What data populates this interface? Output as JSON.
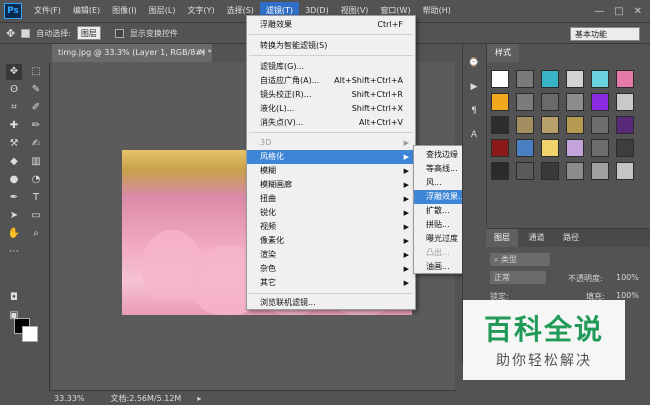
{
  "menubar": {
    "logo": "Ps",
    "items": [
      "文件(F)",
      "编辑(E)",
      "图像(I)",
      "图层(L)",
      "文字(Y)",
      "选择(S)",
      "滤镜(T)",
      "3D(D)",
      "视图(V)",
      "窗口(W)",
      "帮助(H)"
    ],
    "window_buttons": [
      "—",
      "□",
      "✕"
    ]
  },
  "optionsbar": {
    "auto_select_label": "自动选择:",
    "auto_select_value": "图层",
    "show_transform_label": "显示变换控件",
    "workspace": "基本功能"
  },
  "document": {
    "tab_title": "timg.jpg @ 33.3% (Layer 1, RGB/8#) *",
    "zoom": "33.33%",
    "doc_size": "文档:2.56M/5.12M"
  },
  "filter_menu": {
    "items": [
      {
        "label": "浮雕效果",
        "shortcut": "Ctrl+F"
      },
      {
        "label": "转换为智能滤镜(S)"
      },
      {
        "label": "滤镜库(G)..."
      },
      {
        "label": "自适应广角(A)...",
        "shortcut": "Alt+Shift+Ctrl+A"
      },
      {
        "label": "镜头校正(R)...",
        "shortcut": "Shift+Ctrl+R"
      },
      {
        "label": "液化(L)...",
        "shortcut": "Shift+Ctrl+X"
      },
      {
        "label": "消失点(V)...",
        "shortcut": "Alt+Ctrl+V"
      },
      {
        "label": "3D"
      },
      {
        "label": "风格化"
      },
      {
        "label": "模糊"
      },
      {
        "label": "模糊画廊"
      },
      {
        "label": "扭曲"
      },
      {
        "label": "锐化"
      },
      {
        "label": "视频"
      },
      {
        "label": "像素化"
      },
      {
        "label": "渲染"
      },
      {
        "label": "杂色"
      },
      {
        "label": "其它"
      },
      {
        "label": "浏览联机滤镜..."
      }
    ]
  },
  "stylize_submenu": {
    "items": [
      "查找边缘",
      "等高线...",
      "风...",
      "浮雕效果...",
      "扩散...",
      "拼贴...",
      "曝光过度",
      "凸出...",
      "油画..."
    ]
  },
  "styles_panel": {
    "tab": "样式",
    "colors": [
      "#ffffff",
      "#7a7a7a",
      "#39b4c7",
      "#d3d3d3",
      "#6bd3e0",
      "#e57aa8",
      "#f2a81d",
      "#7b7b7b",
      "#6a6a6a",
      "#8c8c8c",
      "#8a2be2",
      "#c9c9c9",
      "#2e2e2e",
      "#a38d61",
      "#b7a06a",
      "#b59a52",
      "#6e6e6e",
      "#5a2a7a",
      "#8c1a1a",
      "#4a7fc2",
      "#f0d36b",
      "#c3a3d9",
      "#6d6d6d",
      "#3d3d3d",
      "#2b2b2b",
      "#5b5b5b",
      "#3a3a3a",
      "#8d8d8d",
      "#a0a0a0",
      "#c4c4c4"
    ]
  },
  "layers_panel": {
    "tabs": [
      "图层",
      "通道",
      "路径"
    ],
    "filter_kind": "类型",
    "blend_mode": "正常",
    "opacity_label": "不透明度:",
    "opacity": "100%",
    "lock_label": "锁定:",
    "fill_label": "填充:",
    "fill": "100%"
  },
  "watermark": {
    "title": "百科全说",
    "subtitle": "助你轻松解决"
  }
}
